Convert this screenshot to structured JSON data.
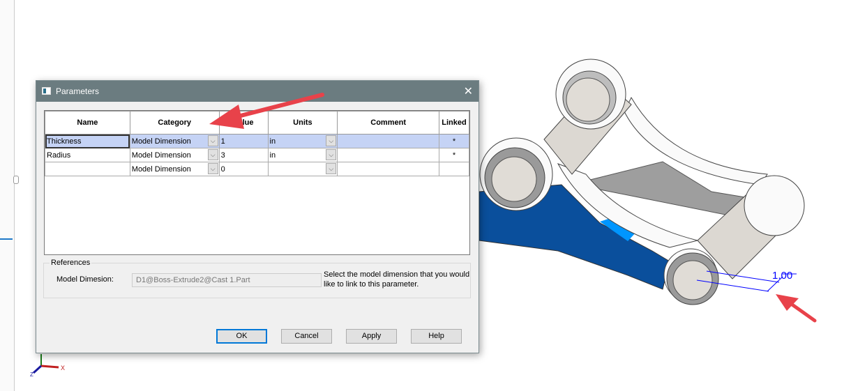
{
  "dialog": {
    "title": "Parameters",
    "columns": [
      "Name",
      "Category",
      "Value",
      "Units",
      "Comment",
      "Linked"
    ],
    "rows": [
      {
        "name": "Thickness",
        "category": "Model Dimension",
        "value": "1",
        "units": "in",
        "comment": "",
        "linked": "*"
      },
      {
        "name": "Radius",
        "category": "Model Dimension",
        "value": "3",
        "units": "in",
        "comment": "",
        "linked": "*"
      },
      {
        "name": "",
        "category": "Model Dimension",
        "value": "0",
        "units": "",
        "comment": "",
        "linked": ""
      }
    ],
    "references": {
      "group_label": "References",
      "model_dimension_label": "Model Dimesion:",
      "model_dimension_value": "D1@Boss-Extrude2@Cast 1.Part",
      "help_text": "Select the model dimension that you would like to link to this parameter."
    },
    "buttons": {
      "ok": "OK",
      "cancel": "Cancel",
      "apply": "Apply",
      "help": "Help"
    }
  },
  "viewport": {
    "dimension_label": "1.00",
    "axis_x_label": "X",
    "axis_z_label": "Z",
    "colors": {
      "selected_face": "#0a4f9c",
      "highlight": "#0096ff",
      "annotation_arrow": "#e8424a",
      "dimension": "#0000ff"
    }
  }
}
